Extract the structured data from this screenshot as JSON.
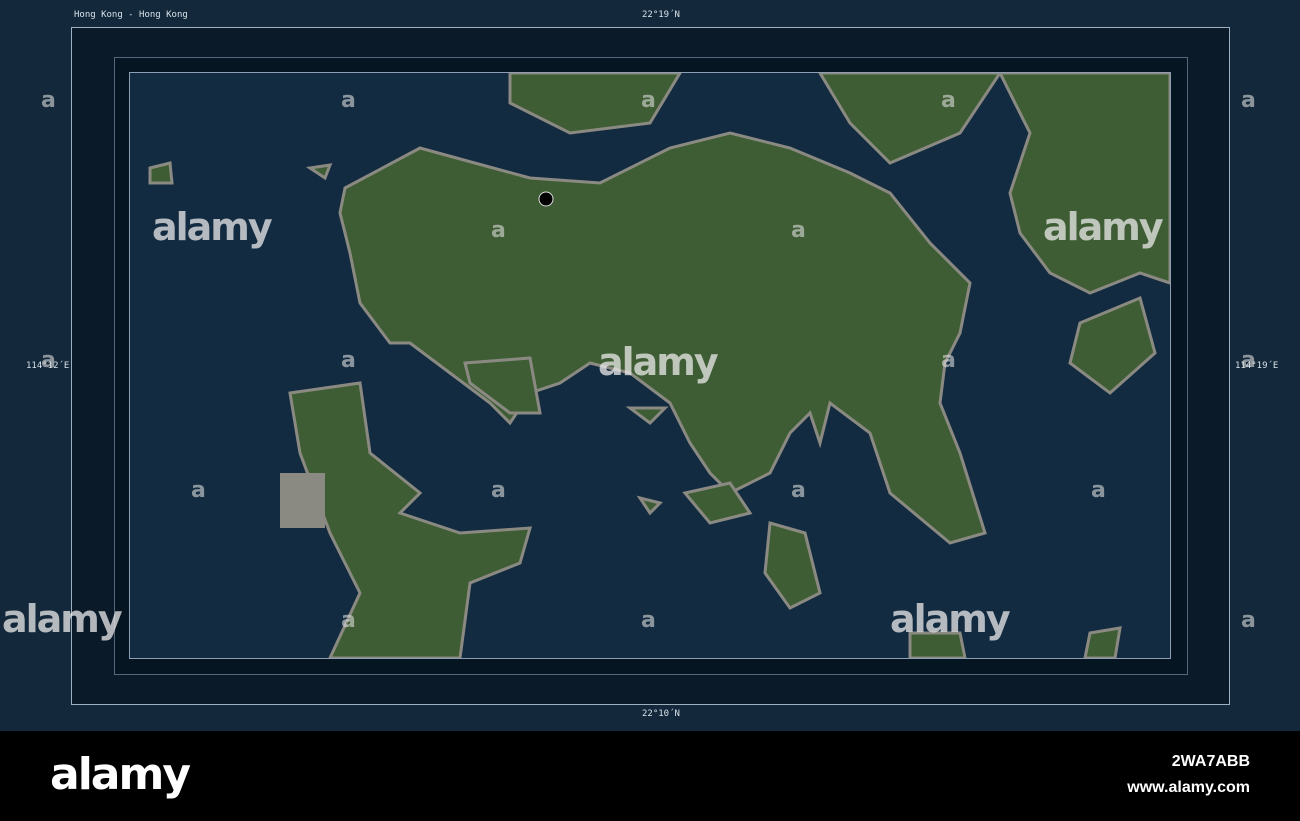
{
  "title": "Hong Kong - Hong Kong",
  "coords": {
    "top": "22°19´N",
    "bottom": "22°10´N",
    "left": "114°12´E",
    "right": "114°19´E"
  },
  "watermark": "alamy",
  "footer": {
    "logo": "alamy",
    "image_id": "2WA7ABB",
    "url": "www.alamy.com"
  },
  "colors": {
    "water": "#132b40",
    "land": "#3f5d34",
    "urban": "#8a8a82",
    "marker": "#000000"
  }
}
